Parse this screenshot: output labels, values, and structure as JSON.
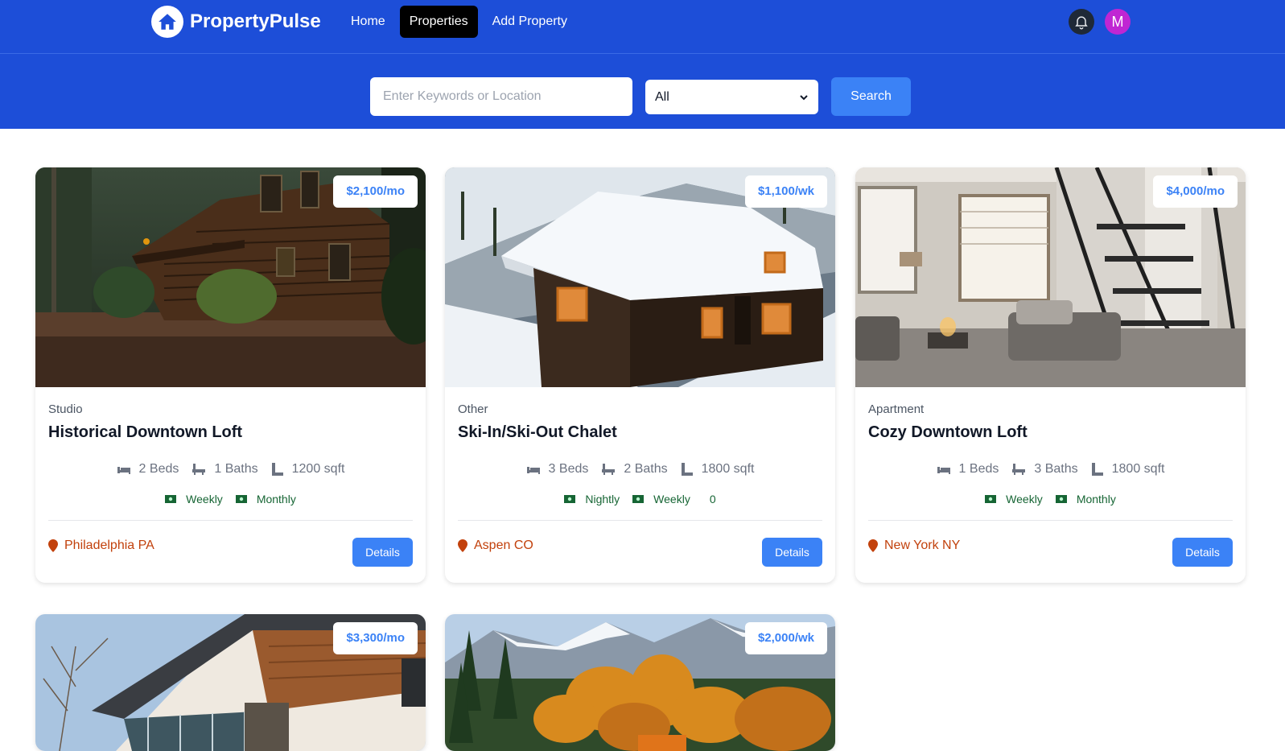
{
  "app": {
    "name": "PropertyPulse",
    "avatar_initial": "M"
  },
  "nav": {
    "links": [
      {
        "label": "Home",
        "active": false
      },
      {
        "label": "Properties",
        "active": true
      },
      {
        "label": "Add Property",
        "active": false
      }
    ]
  },
  "search": {
    "placeholder": "Enter Keywords or Location",
    "type_selected": "All",
    "button_label": "Search"
  },
  "colors": {
    "brand_blue": "#1d4ed8",
    "accent_blue": "#3b82f6",
    "location_orange": "#c2410c",
    "rate_green": "#166534"
  },
  "properties": [
    {
      "type": "Studio",
      "name": "Historical Downtown Loft",
      "price": "$2,100/mo",
      "beds": "2 Beds",
      "baths": "1 Baths",
      "sqft": "1200 sqft",
      "rates": [
        "Weekly",
        "Monthly"
      ],
      "rate_extra": "",
      "location": "Philadelphia PA",
      "details_label": "Details",
      "image": "log-cabin-forest"
    },
    {
      "type": "Other",
      "name": "Ski-In/Ski-Out Chalet",
      "price": "$1,100/wk",
      "beds": "3 Beds",
      "baths": "2 Baths",
      "sqft": "1800 sqft",
      "rates": [
        "Nightly",
        "Weekly"
      ],
      "rate_extra": "0",
      "location": "Aspen CO",
      "details_label": "Details",
      "image": "snowy-chalet"
    },
    {
      "type": "Apartment",
      "name": "Cozy Downtown Loft",
      "price": "$4,000/mo",
      "beds": "1 Beds",
      "baths": "3 Baths",
      "sqft": "1800 sqft",
      "rates": [
        "Weekly",
        "Monthly"
      ],
      "rate_extra": "",
      "location": "New York NY",
      "details_label": "Details",
      "image": "loft-interior-staircase"
    },
    {
      "price": "$3,300/mo",
      "image": "modern-house-exterior"
    },
    {
      "price": "$2,000/wk",
      "image": "mountain-autumn-forest"
    }
  ]
}
